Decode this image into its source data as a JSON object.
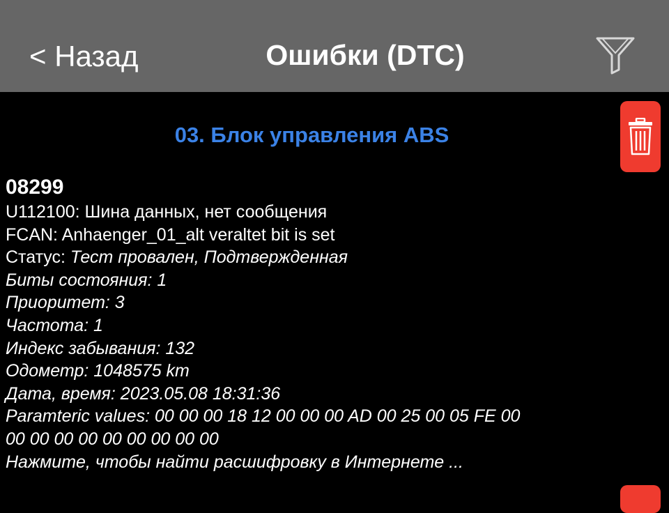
{
  "navbar": {
    "back_label": "< Назад",
    "title": "Ошибки (DTC)",
    "filter_icon": "funnel-icon",
    "background": "#666666"
  },
  "module": {
    "title": "03. Блок управления ABS",
    "title_color": "#3b82e6",
    "delete_icon": "trash-icon",
    "delete_color": "#ef3b2f"
  },
  "dtc": {
    "code": "08299",
    "description": "U112100: Шина данных, нет сообщения",
    "detail": "FCAN: Anhaenger_01_alt veraltet bit is set",
    "status_label": "Статус: ",
    "status_value": "Тест провален, Подтвержденная",
    "status_bits": "Биты состояния: 1",
    "priority": "Приоритет: 3",
    "frequency": "Частота: 1",
    "forget_index": "Индекс забывания: 132",
    "odometer": "Одометр: 1048575 km",
    "datetime": "Дата, время: 2023.05.08 18:31:36",
    "param_values_1": "Paramteric values:  00 00 00 18 12 00 00 00 AD 00 25 00 05 FE 00",
    "param_values_2": "00 00 00 00 00 00 00 00 00",
    "search_link": "Нажмите, чтобы найти расшифровку в Интернете ..."
  }
}
